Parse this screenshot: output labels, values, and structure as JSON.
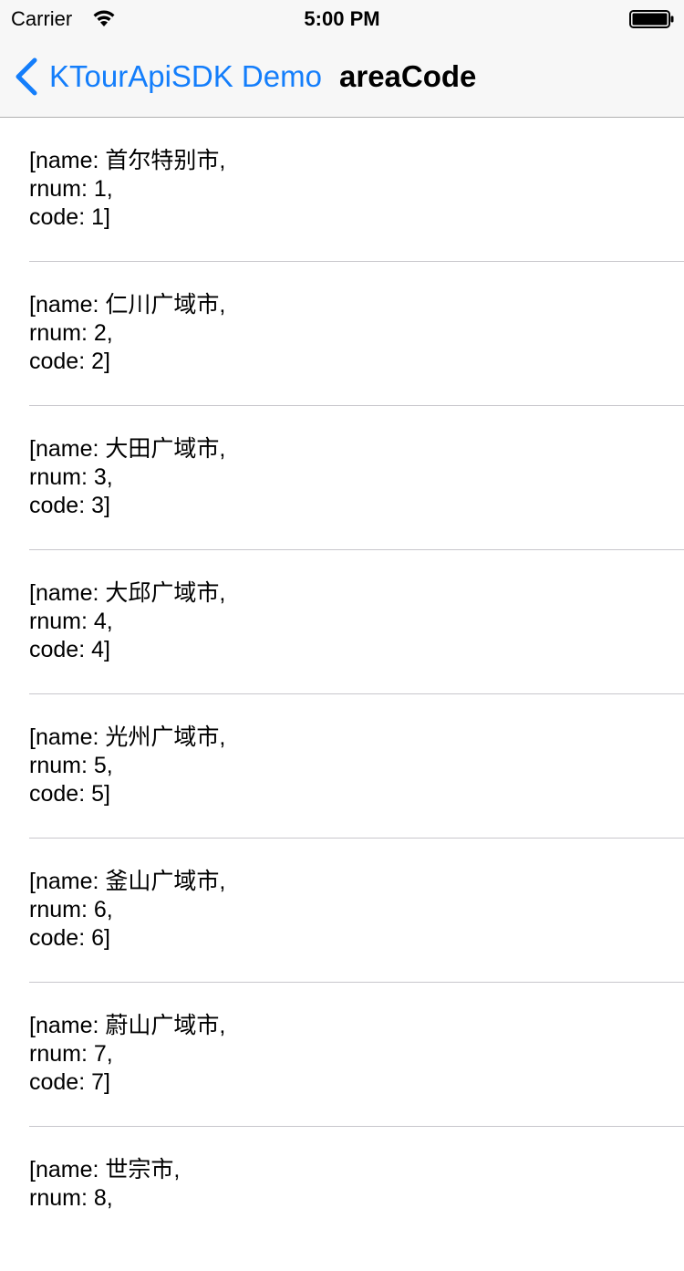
{
  "status_bar": {
    "carrier": "Carrier",
    "time": "5:00 PM",
    "icons": [
      "wifi-icon",
      "battery-icon"
    ]
  },
  "nav": {
    "back_label": "KTourApiSDK Demo",
    "title": "areaCode",
    "accent_color": "#147efb"
  },
  "rows": [
    {
      "line1": "[name: 首尔特别市,",
      "line2": "rnum: 1,",
      "line3": "code: 1]"
    },
    {
      "line1": "[name: 仁川广域市,",
      "line2": "rnum: 2,",
      "line3": "code: 2]"
    },
    {
      "line1": "[name: 大田广域市,",
      "line2": "rnum: 3,",
      "line3": "code: 3]"
    },
    {
      "line1": "[name: 大邱广域市,",
      "line2": "rnum: 4,",
      "line3": "code: 4]"
    },
    {
      "line1": "[name: 光州广域市,",
      "line2": "rnum: 5,",
      "line3": "code: 5]"
    },
    {
      "line1": "[name: 釜山广域市,",
      "line2": "rnum: 6,",
      "line3": "code: 6]"
    },
    {
      "line1": "[name: 蔚山广域市,",
      "line2": "rnum: 7,",
      "line3": "code: 7]"
    },
    {
      "line1": "[name: 世宗市,",
      "line2": "rnum: 8,",
      "line3": ""
    }
  ]
}
